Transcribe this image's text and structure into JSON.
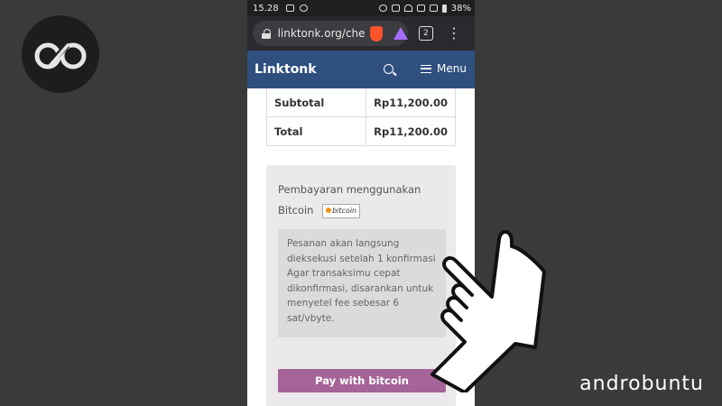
{
  "status_bar": {
    "time": "15.28",
    "battery": "38%"
  },
  "browser": {
    "url": "linktonk.org/che",
    "tab_count": "2"
  },
  "site_nav": {
    "title": "Linktonk",
    "menu_label": "Menu"
  },
  "totals": [
    {
      "label": "Subtotal",
      "value": "Rp11,200.00"
    },
    {
      "label": "Total",
      "value": "Rp11,200.00"
    }
  ],
  "payment": {
    "label_line1": "Pembayaran menggunakan",
    "label_line2": "Bitcoin",
    "badge_text": "bitcoin",
    "info_lines": [
      "Pesanan akan langsung",
      "dieksekusi setelah 1 konfirmasi",
      "Agar transaksimu cepat",
      "dikonfirmasi, disarankan untuk",
      "menyetel fee sebesar 6",
      "sat/vbyte."
    ],
    "pay_button_label": "Pay with bitcoin"
  },
  "watermark": "androbuntu",
  "colors": {
    "nav_bg": "#2f4f7f",
    "pay_button": "#a46497",
    "page_bg": "#3a3a3a"
  }
}
